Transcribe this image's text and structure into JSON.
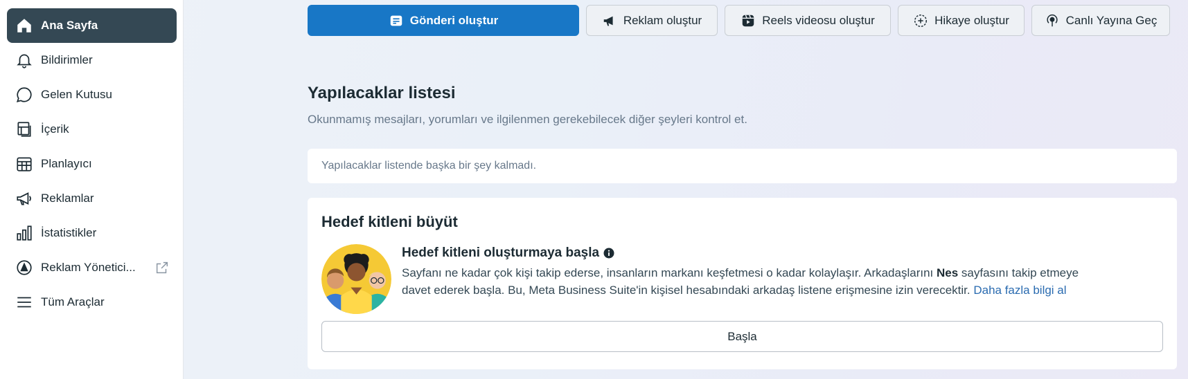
{
  "sidebar": {
    "items": [
      {
        "label": "Ana Sayfa",
        "icon": "home-icon"
      },
      {
        "label": "Bildirimler",
        "icon": "bell-icon"
      },
      {
        "label": "Gelen Kutusu",
        "icon": "chat-bubble-icon"
      },
      {
        "label": "İçerik",
        "icon": "content-icon"
      },
      {
        "label": "Planlayıcı",
        "icon": "calendar-icon"
      },
      {
        "label": "Reklamlar",
        "icon": "megaphone-icon"
      },
      {
        "label": "İstatistikler",
        "icon": "bar-chart-icon"
      },
      {
        "label": "Reklam Yönetici...",
        "icon": "ads-manager-icon"
      },
      {
        "label": "Tüm Araçlar",
        "icon": "menu-icon"
      }
    ],
    "active_index": 0
  },
  "actions": {
    "create_post": "Gönderi oluştur",
    "create_ad": "Reklam oluştur",
    "create_reel": "Reels videosu oluştur",
    "create_story": "Hikaye oluştur",
    "go_live": "Canlı Yayına Geç"
  },
  "todo": {
    "title": "Yapılacaklar listesi",
    "subtitle": "Okunmamış mesajları, yorumları ve ilgilenmen gerekebilecek diğer şeyleri kontrol et.",
    "empty_message": "Yapılacaklar listende başka bir şey kalmadı."
  },
  "grow_audience": {
    "title": "Hedef kitleni büyüt",
    "subtitle": "Hedef kitleni oluşturmaya başla",
    "desc_part1": "Sayfanı ne kadar çok kişi takip ederse, insanların markanı keşfetmesi o kadar kolaylaşır. Arkadaşlarını ",
    "page_name": "Nes",
    "desc_part2": " sayfasını takip etmeye davet ederek başla. Bu, Meta Business Suite'in kişisel hesabındaki arkadaş listene erişmesine izin verecektir. ",
    "learn_more": "Daha fazla bilgi al",
    "start_button": "Başla"
  },
  "colors": {
    "accent": "#1877c6",
    "active_nav": "#344854",
    "link": "#2a6bb0"
  }
}
